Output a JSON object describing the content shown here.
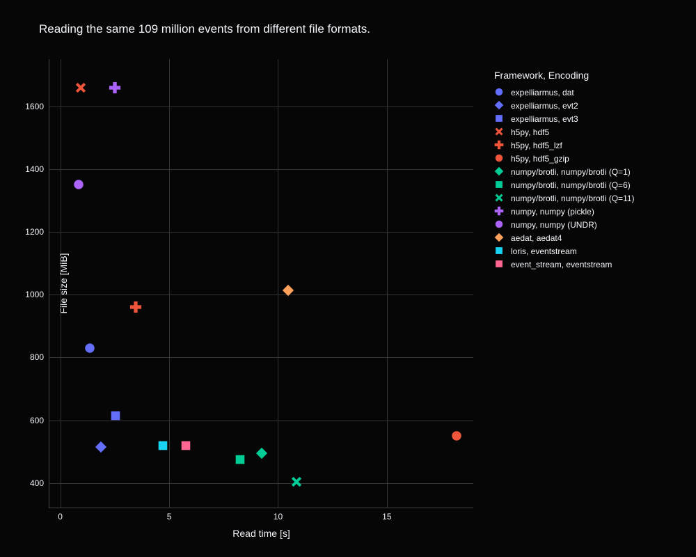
{
  "title": "Reading the same 109 million events from different file formats.",
  "legend_title": "Framework, Encoding",
  "xlabel": "Read time [s]",
  "ylabel": "File size [MiB]",
  "x_ticks": [
    0,
    5,
    10,
    15
  ],
  "y_ticks": [
    400,
    600,
    800,
    1000,
    1200,
    1400,
    1600
  ],
  "x_range": [
    -0.5,
    19
  ],
  "y_range": [
    320,
    1750
  ],
  "chart_data": {
    "type": "scatter",
    "title": "Reading the same 109 million events from different file formats.",
    "xlabel": "Read time [s]",
    "ylabel": "File size [MiB]",
    "xlim": [
      -0.5,
      19
    ],
    "ylim": [
      320,
      1750
    ],
    "series": [
      {
        "name": "expelliarmus, dat",
        "shape": "circle",
        "color": "#636efa",
        "x": 1.35,
        "y": 830
      },
      {
        "name": "expelliarmus, evt2",
        "shape": "diamond",
        "color": "#636efa",
        "x": 1.85,
        "y": 515
      },
      {
        "name": "expelliarmus, evt3",
        "shape": "square",
        "color": "#636efa",
        "x": 2.55,
        "y": 615
      },
      {
        "name": "h5py, hdf5",
        "shape": "x",
        "color": "#ef553b",
        "x": 0.95,
        "y": 1660
      },
      {
        "name": "h5py, hdf5_lzf",
        "shape": "plus",
        "color": "#ef553b",
        "x": 3.45,
        "y": 960
      },
      {
        "name": "h5py, hdf5_gzip",
        "shape": "circle",
        "color": "#ef553b",
        "x": 18.2,
        "y": 550
      },
      {
        "name": "numpy/brotli, numpy/brotli (Q=1)",
        "shape": "diamond",
        "color": "#00cc96",
        "x": 9.25,
        "y": 495
      },
      {
        "name": "numpy/brotli, numpy/brotli (Q=6)",
        "shape": "square",
        "color": "#00cc96",
        "x": 8.25,
        "y": 475
      },
      {
        "name": "numpy/brotli, numpy/brotli (Q=11)",
        "shape": "x",
        "color": "#00cc96",
        "x": 10.85,
        "y": 405
      },
      {
        "name": "numpy, numpy (pickle)",
        "shape": "plus",
        "color": "#ab63fa",
        "x": 2.5,
        "y": 1660
      },
      {
        "name": "numpy, numpy (UNDR)",
        "shape": "circle",
        "color": "#ab63fa",
        "x": 0.85,
        "y": 1350
      },
      {
        "name": "aedat, aedat4",
        "shape": "diamond",
        "color": "#ffa15a",
        "x": 10.45,
        "y": 1015
      },
      {
        "name": "loris, eventstream",
        "shape": "square",
        "color": "#19d3f3",
        "x": 4.7,
        "y": 520
      },
      {
        "name": "event_stream, eventstream",
        "shape": "square",
        "color": "#ff6692",
        "x": 5.75,
        "y": 520
      }
    ]
  }
}
